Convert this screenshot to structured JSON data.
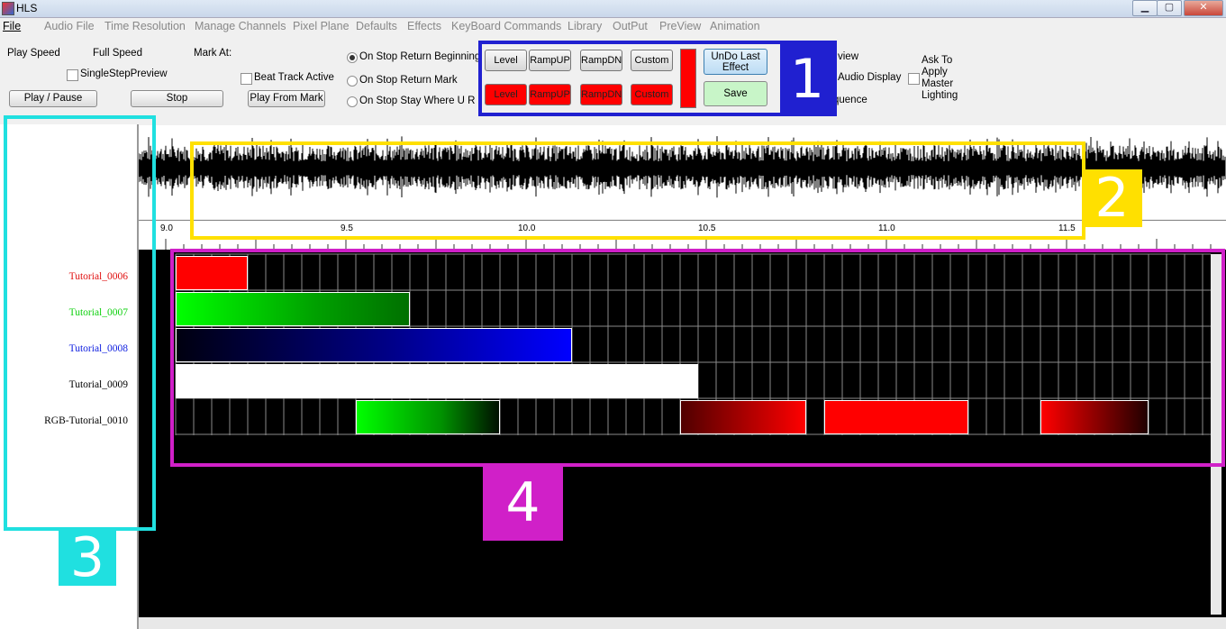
{
  "window": {
    "title": "HLS",
    "minimize": "▁",
    "maximize": "▢",
    "close": "✕"
  },
  "menu": [
    "File",
    "Audio File",
    "Time Resolution",
    "Manage Channels",
    "Pixel Plane",
    "Defaults",
    "Effects",
    "KeyBoard Commands",
    "Library",
    "OutPut",
    "PreView",
    "Animation"
  ],
  "controls": {
    "play_speed": "Play Speed",
    "full_speed": "Full Speed",
    "single_step": "SingleStepPreview",
    "mark_at": "Mark At:",
    "beat_track": "Beat Track Active",
    "play_pause": "Play / Pause",
    "stop": "Stop",
    "play_from_mark": "Play From Mark",
    "on_stop_return_beginning": "On Stop Return Beginning",
    "on_stop_return_mark": "On Stop Return Mark",
    "on_stop_stay": "On Stop Stay Where U R",
    "preview_partial": "view",
    "audio_display": "Audio Display",
    "sequence_partial": "quence",
    "ask_to_apply": "Ask To Apply Master Lighting"
  },
  "effects": {
    "top_row": [
      "Level",
      "RampUP",
      "RampDN",
      "Custom"
    ],
    "bottom_row": [
      "Level",
      "RampUP",
      "RampDN",
      "Custom"
    ],
    "undo": "UnDo Last Effect",
    "save": "Save"
  },
  "overlays": [
    "1",
    "2",
    "3",
    "4"
  ],
  "ruler": {
    "labels": [
      "9.0",
      "9.5",
      "10.0",
      "10.5",
      "11.0",
      "11.5"
    ]
  },
  "channels": [
    {
      "name": "Tutorial_0006",
      "color": "#e01010"
    },
    {
      "name": "Tutorial_0007",
      "color": "#10d010"
    },
    {
      "name": "Tutorial_0008",
      "color": "#1020e0"
    },
    {
      "name": "Tutorial_0009",
      "color": "#000000"
    },
    {
      "name": "RGB-Tutorial_0010",
      "color": "#000000"
    }
  ],
  "colors": {
    "overlay1": "#2020d0",
    "overlay2": "#ffe000",
    "overlay3": "#20e0e0",
    "overlay4": "#d020c8"
  }
}
